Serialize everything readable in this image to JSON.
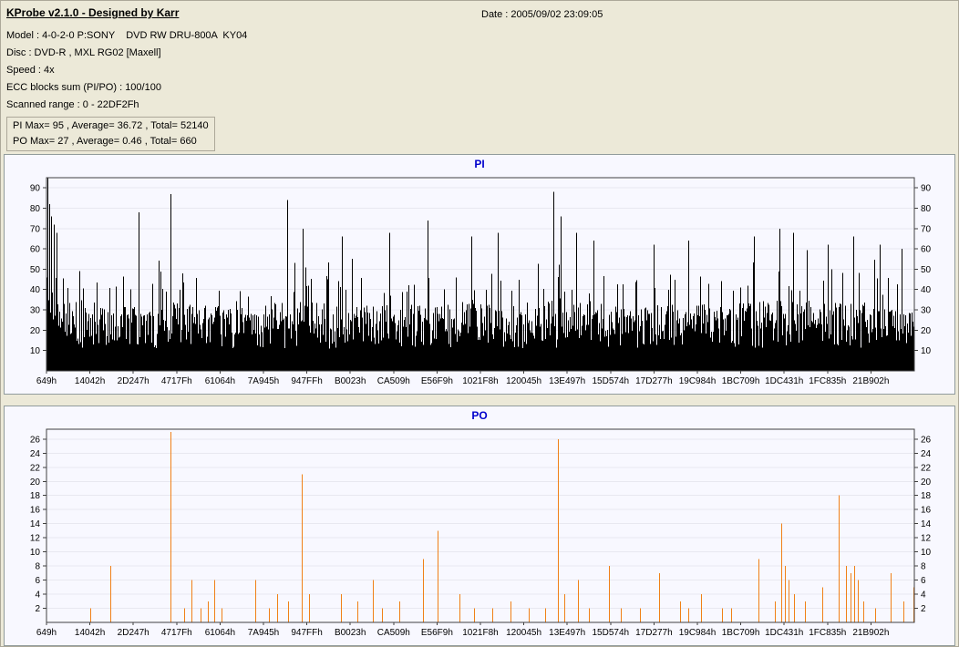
{
  "header": {
    "app_title": "KProbe v2.1.0 - Designed by Karr",
    "date": "Date : 2005/09/02 23:09:05",
    "info_lines": [
      "Model : 4-0-2-0 P:SONY    DVD RW DRU-800A  KY04",
      "Disc : DVD-R , MXL RG02 [Maxell]",
      "Speed : 4x",
      "ECC blocks sum (PI/PO) : 100/100",
      "Scanned range : 0 - 22DF2Fh"
    ],
    "summary_lines": [
      "PI Max= 95 , Average= 36.72 , Total= 52140",
      "PO Max= 27 , Average= 0.46 , Total= 660"
    ]
  },
  "colors": {
    "window_bg": "#ECE9D8",
    "panel_bg": "#F8F8FF",
    "title_blue": "#0000CC",
    "pi_bar": "#000000",
    "po_bar": "#F08018",
    "axis": "#404040",
    "grid": "#E8E8F0"
  },
  "chart_data": [
    {
      "id": "pi",
      "type": "bar",
      "title": "PI",
      "stats": {
        "max": 95,
        "average": 36.72,
        "total": 52140
      },
      "ylim": [
        0,
        95
      ],
      "y_max": 95,
      "y_ticks": [
        10,
        20,
        30,
        40,
        50,
        60,
        70,
        80,
        90
      ],
      "x_labels": [
        "649h",
        "14042h",
        "2D247h",
        "4717Fh",
        "61064h",
        "7A945h",
        "947FFh",
        "B0023h",
        "CA509h",
        "E56F9h",
        "1021F8h",
        "120045h",
        "13E497h",
        "15D574h",
        "17D277h",
        "19C984h",
        "1BC709h",
        "1DC431h",
        "1FC835h",
        "21B902h"
      ],
      "bar_color": "#000000",
      "generator": {
        "seed": 1337,
        "base_min": 11,
        "base_span": 17,
        "envelope": [
          [
            0.0,
            92
          ],
          [
            0.004,
            80
          ],
          [
            0.01,
            70
          ],
          [
            0.02,
            64
          ],
          [
            0.05,
            58
          ],
          [
            0.09,
            60
          ],
          [
            0.12,
            58
          ],
          [
            0.15,
            60
          ],
          [
            0.18,
            56
          ],
          [
            0.22,
            54
          ],
          [
            0.26,
            58
          ],
          [
            0.3,
            60
          ],
          [
            0.34,
            56
          ],
          [
            0.38,
            58
          ],
          [
            0.42,
            60
          ],
          [
            0.46,
            56
          ],
          [
            0.5,
            62
          ],
          [
            0.54,
            60
          ],
          [
            0.58,
            64
          ],
          [
            0.62,
            60
          ],
          [
            0.66,
            54
          ],
          [
            0.7,
            56
          ],
          [
            0.74,
            58
          ],
          [
            0.78,
            54
          ],
          [
            0.82,
            62
          ],
          [
            0.86,
            64
          ],
          [
            0.9,
            58
          ],
          [
            0.94,
            60
          ],
          [
            0.97,
            56
          ],
          [
            1.0,
            54
          ]
        ]
      },
      "peaks": [
        [
          0.001,
          95
        ],
        [
          0.003,
          82
        ],
        [
          0.005,
          76
        ],
        [
          0.008,
          72
        ],
        [
          0.012,
          68
        ],
        [
          0.106,
          78
        ],
        [
          0.143,
          87
        ],
        [
          0.277,
          84
        ],
        [
          0.295,
          70
        ],
        [
          0.34,
          66
        ],
        [
          0.395,
          68
        ],
        [
          0.439,
          74
        ],
        [
          0.49,
          66
        ],
        [
          0.52,
          68
        ],
        [
          0.584,
          88
        ],
        [
          0.592,
          76
        ],
        [
          0.61,
          68
        ],
        [
          0.63,
          64
        ],
        [
          0.7,
          62
        ],
        [
          0.74,
          64
        ],
        [
          0.815,
          66
        ],
        [
          0.845,
          70
        ],
        [
          0.86,
          68
        ],
        [
          0.9,
          62
        ],
        [
          0.93,
          66
        ],
        [
          0.96,
          62
        ],
        [
          0.985,
          60
        ]
      ]
    },
    {
      "id": "po",
      "type": "bar",
      "title": "PO",
      "stats": {
        "max": 27,
        "average": 0.46,
        "total": 660
      },
      "ylim": [
        0,
        27.4
      ],
      "y_max": 27.4,
      "y_ticks": [
        2,
        4,
        6,
        8,
        10,
        12,
        14,
        16,
        18,
        20,
        22,
        24,
        26
      ],
      "x_labels": [
        "649h",
        "14042h",
        "2D247h",
        "4717Fh",
        "61064h",
        "7A945h",
        "947FFh",
        "B0023h",
        "CA509h",
        "E56F9h",
        "1021F8h",
        "120045h",
        "13E497h",
        "15D574h",
        "17D277h",
        "19C984h",
        "1BC709h",
        "1DC431h",
        "1FC835h",
        "21B902h"
      ],
      "bar_color": "#F08018",
      "spikes": [
        [
          0.05,
          2
        ],
        [
          0.074,
          8
        ],
        [
          0.143,
          27
        ],
        [
          0.159,
          2
        ],
        [
          0.167,
          6
        ],
        [
          0.177,
          2
        ],
        [
          0.186,
          3
        ],
        [
          0.193,
          6
        ],
        [
          0.202,
          2
        ],
        [
          0.241,
          6
        ],
        [
          0.256,
          2
        ],
        [
          0.266,
          4
        ],
        [
          0.278,
          3
        ],
        [
          0.294,
          21
        ],
        [
          0.303,
          4
        ],
        [
          0.339,
          4
        ],
        [
          0.358,
          3
        ],
        [
          0.376,
          6
        ],
        [
          0.387,
          2
        ],
        [
          0.407,
          3
        ],
        [
          0.434,
          9
        ],
        [
          0.451,
          13
        ],
        [
          0.476,
          4
        ],
        [
          0.493,
          2
        ],
        [
          0.514,
          2
        ],
        [
          0.535,
          3
        ],
        [
          0.556,
          2
        ],
        [
          0.575,
          2
        ],
        [
          0.589,
          26
        ],
        [
          0.597,
          4
        ],
        [
          0.612,
          6
        ],
        [
          0.625,
          2
        ],
        [
          0.648,
          8
        ],
        [
          0.662,
          2
        ],
        [
          0.684,
          2
        ],
        [
          0.706,
          7
        ],
        [
          0.73,
          3
        ],
        [
          0.739,
          2
        ],
        [
          0.754,
          4
        ],
        [
          0.778,
          2
        ],
        [
          0.789,
          2
        ],
        [
          0.82,
          9
        ],
        [
          0.839,
          3
        ],
        [
          0.847,
          14
        ],
        [
          0.851,
          8
        ],
        [
          0.855,
          6
        ],
        [
          0.861,
          4
        ],
        [
          0.874,
          3
        ],
        [
          0.894,
          5
        ],
        [
          0.913,
          18
        ],
        [
          0.921,
          8
        ],
        [
          0.926,
          7
        ],
        [
          0.931,
          8
        ],
        [
          0.935,
          6
        ],
        [
          0.941,
          3
        ],
        [
          0.955,
          2
        ],
        [
          0.973,
          7
        ],
        [
          0.987,
          3
        ],
        [
          0.999,
          5
        ]
      ]
    }
  ]
}
